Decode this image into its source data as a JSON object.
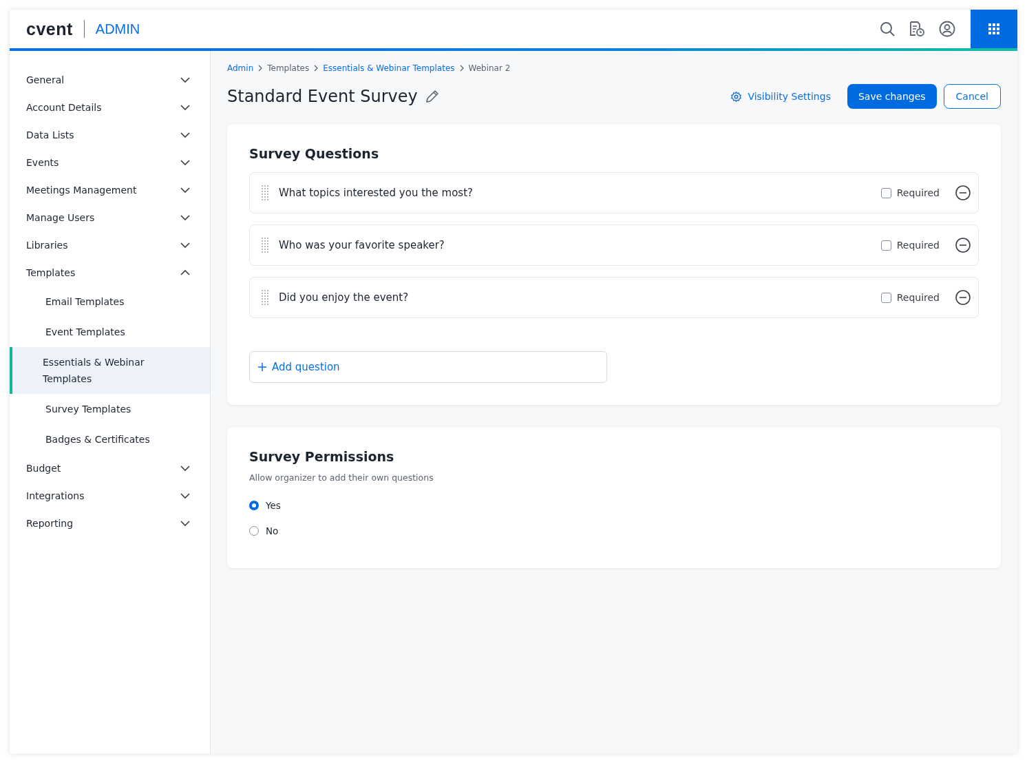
{
  "header": {
    "logo": "cvent",
    "product": "ADMIN"
  },
  "sidebar": {
    "items": [
      {
        "label": "General",
        "expanded": false
      },
      {
        "label": "Account Details",
        "expanded": false
      },
      {
        "label": "Data Lists",
        "expanded": false
      },
      {
        "label": "Events",
        "expanded": false
      },
      {
        "label": "Meetings Management",
        "expanded": false
      },
      {
        "label": "Manage Users",
        "expanded": false
      },
      {
        "label": "Libraries",
        "expanded": false
      },
      {
        "label": "Templates",
        "expanded": true,
        "children": [
          {
            "label": "Email Templates",
            "selected": false
          },
          {
            "label": "Event Templates",
            "selected": false
          },
          {
            "label": "Essentials & Webinar Templates",
            "selected": true
          },
          {
            "label": "Survey Templates",
            "selected": false
          },
          {
            "label": "Badges & Certificates",
            "selected": false
          }
        ]
      },
      {
        "label": "Budget",
        "expanded": false
      },
      {
        "label": "Integrations",
        "expanded": false
      },
      {
        "label": "Reporting",
        "expanded": false
      }
    ]
  },
  "breadcrumb": [
    {
      "label": "Admin",
      "link": true
    },
    {
      "label": "Templates",
      "link": false
    },
    {
      "label": "Essentials & Webinar Templates",
      "link": true
    },
    {
      "label": "Webinar 2",
      "link": false
    }
  ],
  "page": {
    "title": "Standard Event Survey",
    "visibility": "Visibility Settings",
    "save": "Save changes",
    "cancel": "Cancel"
  },
  "questions": {
    "title": "Survey Questions",
    "items": [
      {
        "text": "What topics interested you the most?",
        "required_label": "Required",
        "required": false
      },
      {
        "text": "Who was your favorite speaker?",
        "required_label": "Required",
        "required": false
      },
      {
        "text": "Did you enjoy the event?",
        "required_label": "Required",
        "required": false
      }
    ],
    "add": "Add question"
  },
  "permissions": {
    "title": "Survey Permissions",
    "subtitle": "Allow organizer to add their own questions",
    "options": [
      {
        "label": "Yes",
        "selected": true
      },
      {
        "label": "No",
        "selected": false
      }
    ]
  }
}
